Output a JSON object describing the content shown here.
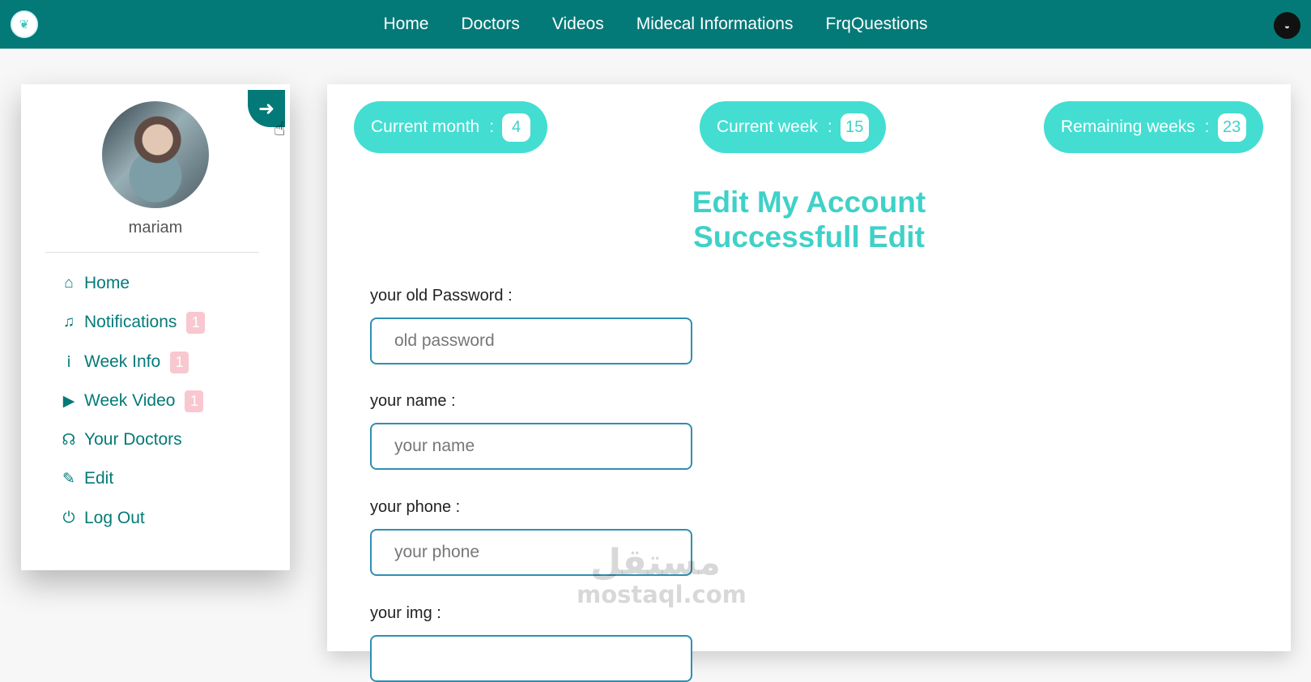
{
  "brand": {
    "logo_icon": "baby-logo-icon"
  },
  "nav": {
    "links": [
      "Home",
      "Doctors",
      "Videos",
      "Midecal Informations",
      "FrqQuestions"
    ],
    "profile_icon": "user-profile-icon"
  },
  "sidebar": {
    "username": "mariam",
    "back_icon": "arrow-left-icon",
    "items": [
      {
        "label": "Home",
        "icon": "home-icon"
      },
      {
        "label": "Notifications",
        "icon": "bell-icon",
        "badge": "1"
      },
      {
        "label": "Week Info",
        "icon": "info-icon",
        "badge": "1"
      },
      {
        "label": "Week Video",
        "icon": "play-icon",
        "badge": "1"
      },
      {
        "label": "Your Doctors",
        "icon": "stethoscope-icon"
      },
      {
        "label": "Edit",
        "icon": "edit-icon"
      },
      {
        "label": "Log Out",
        "icon": "power-icon"
      }
    ]
  },
  "stats": [
    {
      "label": "Current month",
      "separator": ":",
      "value": "4"
    },
    {
      "label": "Current week",
      "separator": ":",
      "value": "15"
    },
    {
      "label": "Remaining weeks",
      "separator": ":",
      "value": "23"
    }
  ],
  "form": {
    "title": "Edit My Account",
    "status": "Successfull Edit",
    "fields": [
      {
        "label": "your old Password :",
        "placeholder": "old password"
      },
      {
        "label": "your name :",
        "placeholder": "your name"
      },
      {
        "label": "your phone :",
        "placeholder": "your phone"
      },
      {
        "label": "your img :",
        "placeholder": ""
      }
    ]
  },
  "watermark": {
    "arabic": "مستقل",
    "latin": "mostaql.com"
  },
  "colors": {
    "primary": "#047a78",
    "accent": "#44ddd2",
    "heading": "#3fd1c8",
    "badge": "#f8c7cf"
  }
}
